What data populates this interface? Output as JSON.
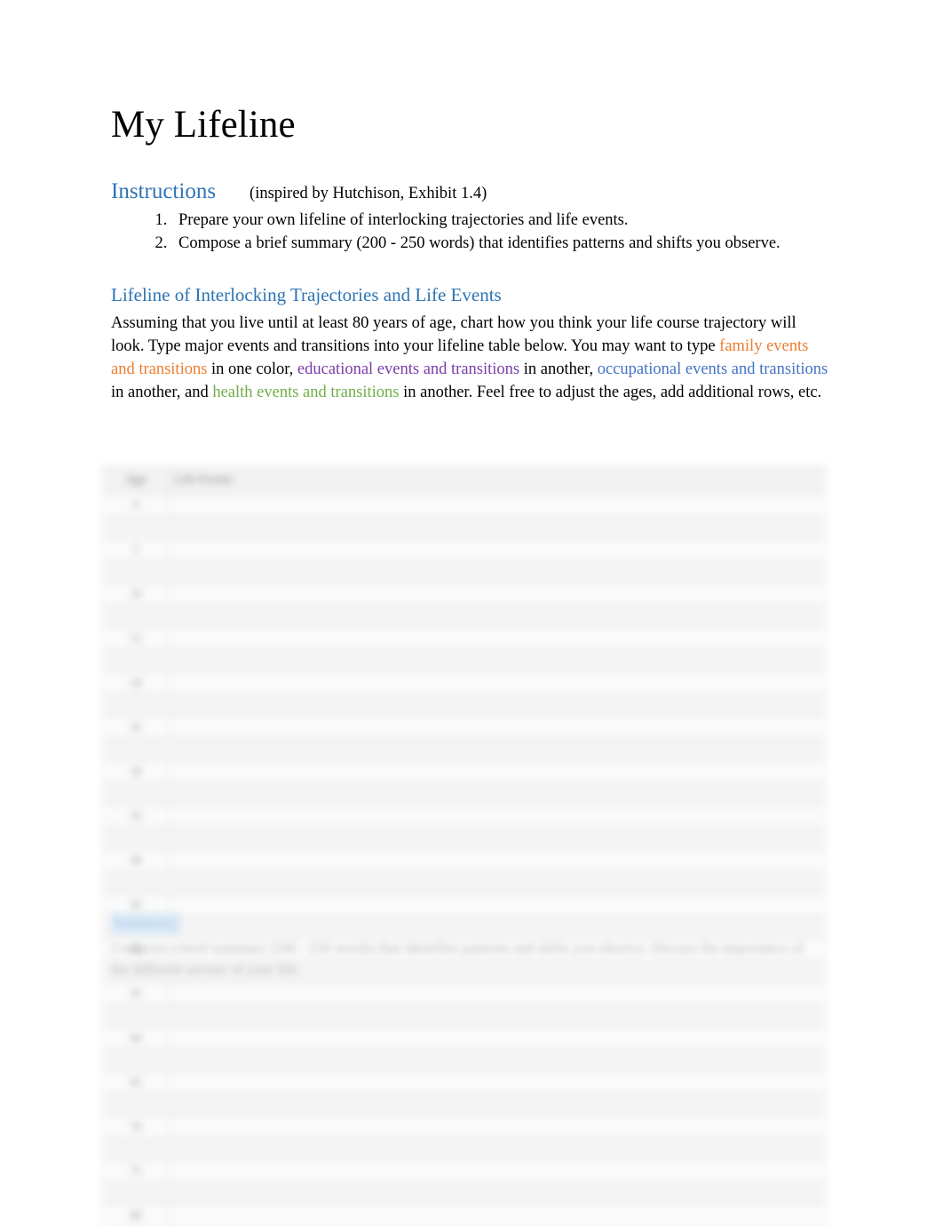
{
  "document": {
    "title": "My Lifeline"
  },
  "instructions": {
    "heading": "Instructions",
    "attribution": "(inspired by Hutchison, Exhibit 1.4)",
    "items": [
      "Prepare your own lifeline of interlocking trajectories and life events.",
      "Compose a brief summary (200 - 250 words) that identifies patterns and shifts you observe."
    ]
  },
  "lifeline_section": {
    "heading": "Lifeline of Interlocking Trajectories and Life Events",
    "paragraph": {
      "part1": "Assuming that you live until at least 80 years of age, chart how you think your life course trajectory will look. Type major events and transitions into your lifeline table below. You may want to type ",
      "family": "family events and transitions",
      "part2": " in one color, ",
      "educational": "educational events and transitions",
      "part3": " in another, ",
      "occupational": "occupational events and transitions",
      "part4": " in another, and ",
      "health": "health events and transitions",
      "part5": " in another. Feel free to adjust the ages, add additional rows, etc."
    },
    "colors": {
      "heading_blue": "#2E74B5",
      "family_orange": "#ED7D31",
      "educational_purple": "#7A3BA8",
      "occupational_blue": "#4472C4",
      "health_green": "#70AD47"
    }
  },
  "lifeline_table": {
    "headers": [
      "Age",
      "Life Events"
    ],
    "rows": [
      {
        "age": "0",
        "events": ""
      },
      {
        "age": "",
        "events": ""
      },
      {
        "age": "5",
        "events": ""
      },
      {
        "age": "",
        "events": ""
      },
      {
        "age": "10",
        "events": ""
      },
      {
        "age": "",
        "events": ""
      },
      {
        "age": "15",
        "events": ""
      },
      {
        "age": "",
        "events": ""
      },
      {
        "age": "20",
        "events": ""
      },
      {
        "age": "",
        "events": ""
      },
      {
        "age": "25",
        "events": ""
      },
      {
        "age": "",
        "events": ""
      },
      {
        "age": "30",
        "events": ""
      },
      {
        "age": "",
        "events": ""
      },
      {
        "age": "35",
        "events": ""
      },
      {
        "age": "",
        "events": ""
      },
      {
        "age": "40",
        "events": ""
      },
      {
        "age": "",
        "events": ""
      },
      {
        "age": "45",
        "events": ""
      },
      {
        "age": "",
        "events": ""
      },
      {
        "age": "50",
        "events": ""
      },
      {
        "age": "",
        "events": ""
      },
      {
        "age": "55",
        "events": ""
      },
      {
        "age": "",
        "events": ""
      },
      {
        "age": "60",
        "events": ""
      },
      {
        "age": "",
        "events": ""
      },
      {
        "age": "65",
        "events": ""
      },
      {
        "age": "",
        "events": ""
      },
      {
        "age": "70",
        "events": ""
      },
      {
        "age": "",
        "events": ""
      },
      {
        "age": "75",
        "events": ""
      },
      {
        "age": "",
        "events": ""
      },
      {
        "age": "80",
        "events": ""
      }
    ]
  },
  "summary_section": {
    "heading": "Summary",
    "line1": "Compose a brief summary (200 - 250 words) that identifies patterns and shifts you observe.",
    "line2": "Discuss the importance of the different sectors of your life."
  }
}
